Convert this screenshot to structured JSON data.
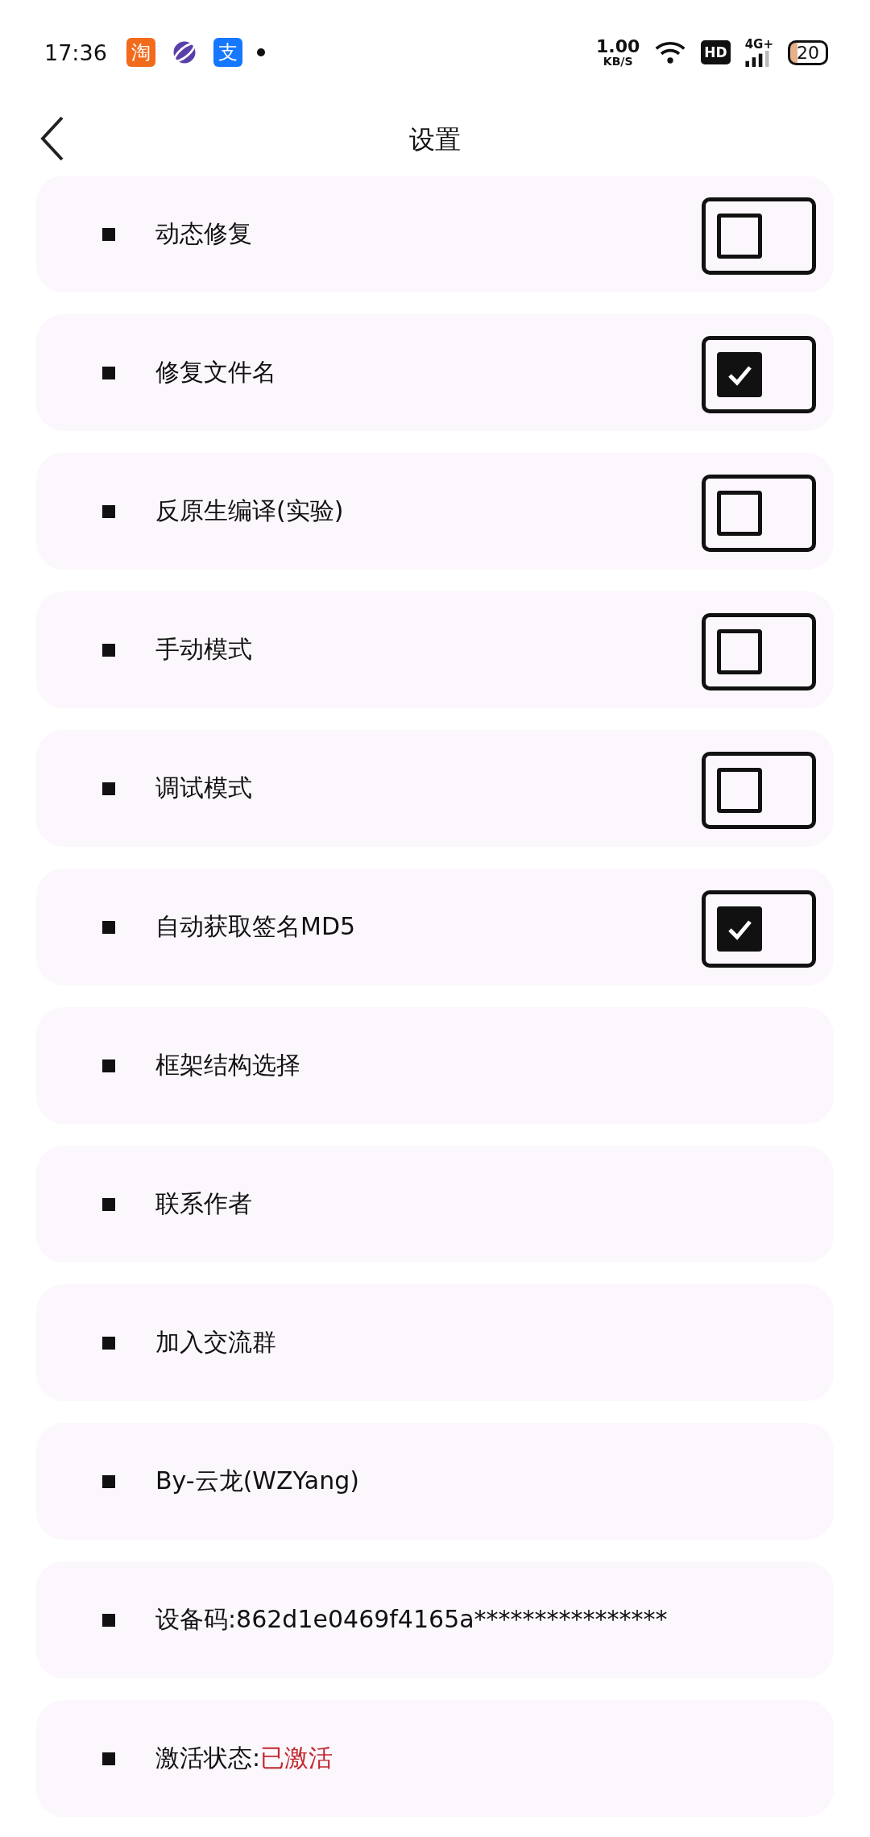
{
  "status_bar": {
    "time": "17:36",
    "app_icons": [
      {
        "kind": "badge",
        "text": "淘",
        "color": "#f26a1b"
      },
      {
        "kind": "planet",
        "color": "#5a3fa8"
      },
      {
        "kind": "badge",
        "text": "支",
        "color": "#1677ff"
      }
    ],
    "network_speed": "1.00",
    "network_unit": "KB/S",
    "hd_badge": "HD",
    "network_type": "4G+",
    "battery": "20"
  },
  "header": {
    "title": "设置"
  },
  "settings": [
    {
      "kind": "checkbox",
      "label": "动态修复",
      "checked": false
    },
    {
      "kind": "checkbox",
      "label": "修复文件名",
      "checked": true
    },
    {
      "kind": "checkbox",
      "label": "反原生编译(实验)",
      "checked": false
    },
    {
      "kind": "checkbox",
      "label": "手动模式",
      "checked": false
    },
    {
      "kind": "checkbox",
      "label": "调试模式",
      "checked": false
    },
    {
      "kind": "checkbox",
      "label": "自动获取签名MD5",
      "checked": true
    },
    {
      "kind": "action",
      "label": "框架结构选择"
    },
    {
      "kind": "action",
      "label": "联系作者"
    },
    {
      "kind": "action",
      "label": "加入交流群"
    },
    {
      "kind": "info",
      "label": "By-云龙(WZYang)"
    },
    {
      "kind": "info",
      "label": "设备码:862d1e0469f4165a****************"
    },
    {
      "kind": "status",
      "label": "激活状态:",
      "value": "已激活",
      "color": "#c0282d"
    }
  ]
}
